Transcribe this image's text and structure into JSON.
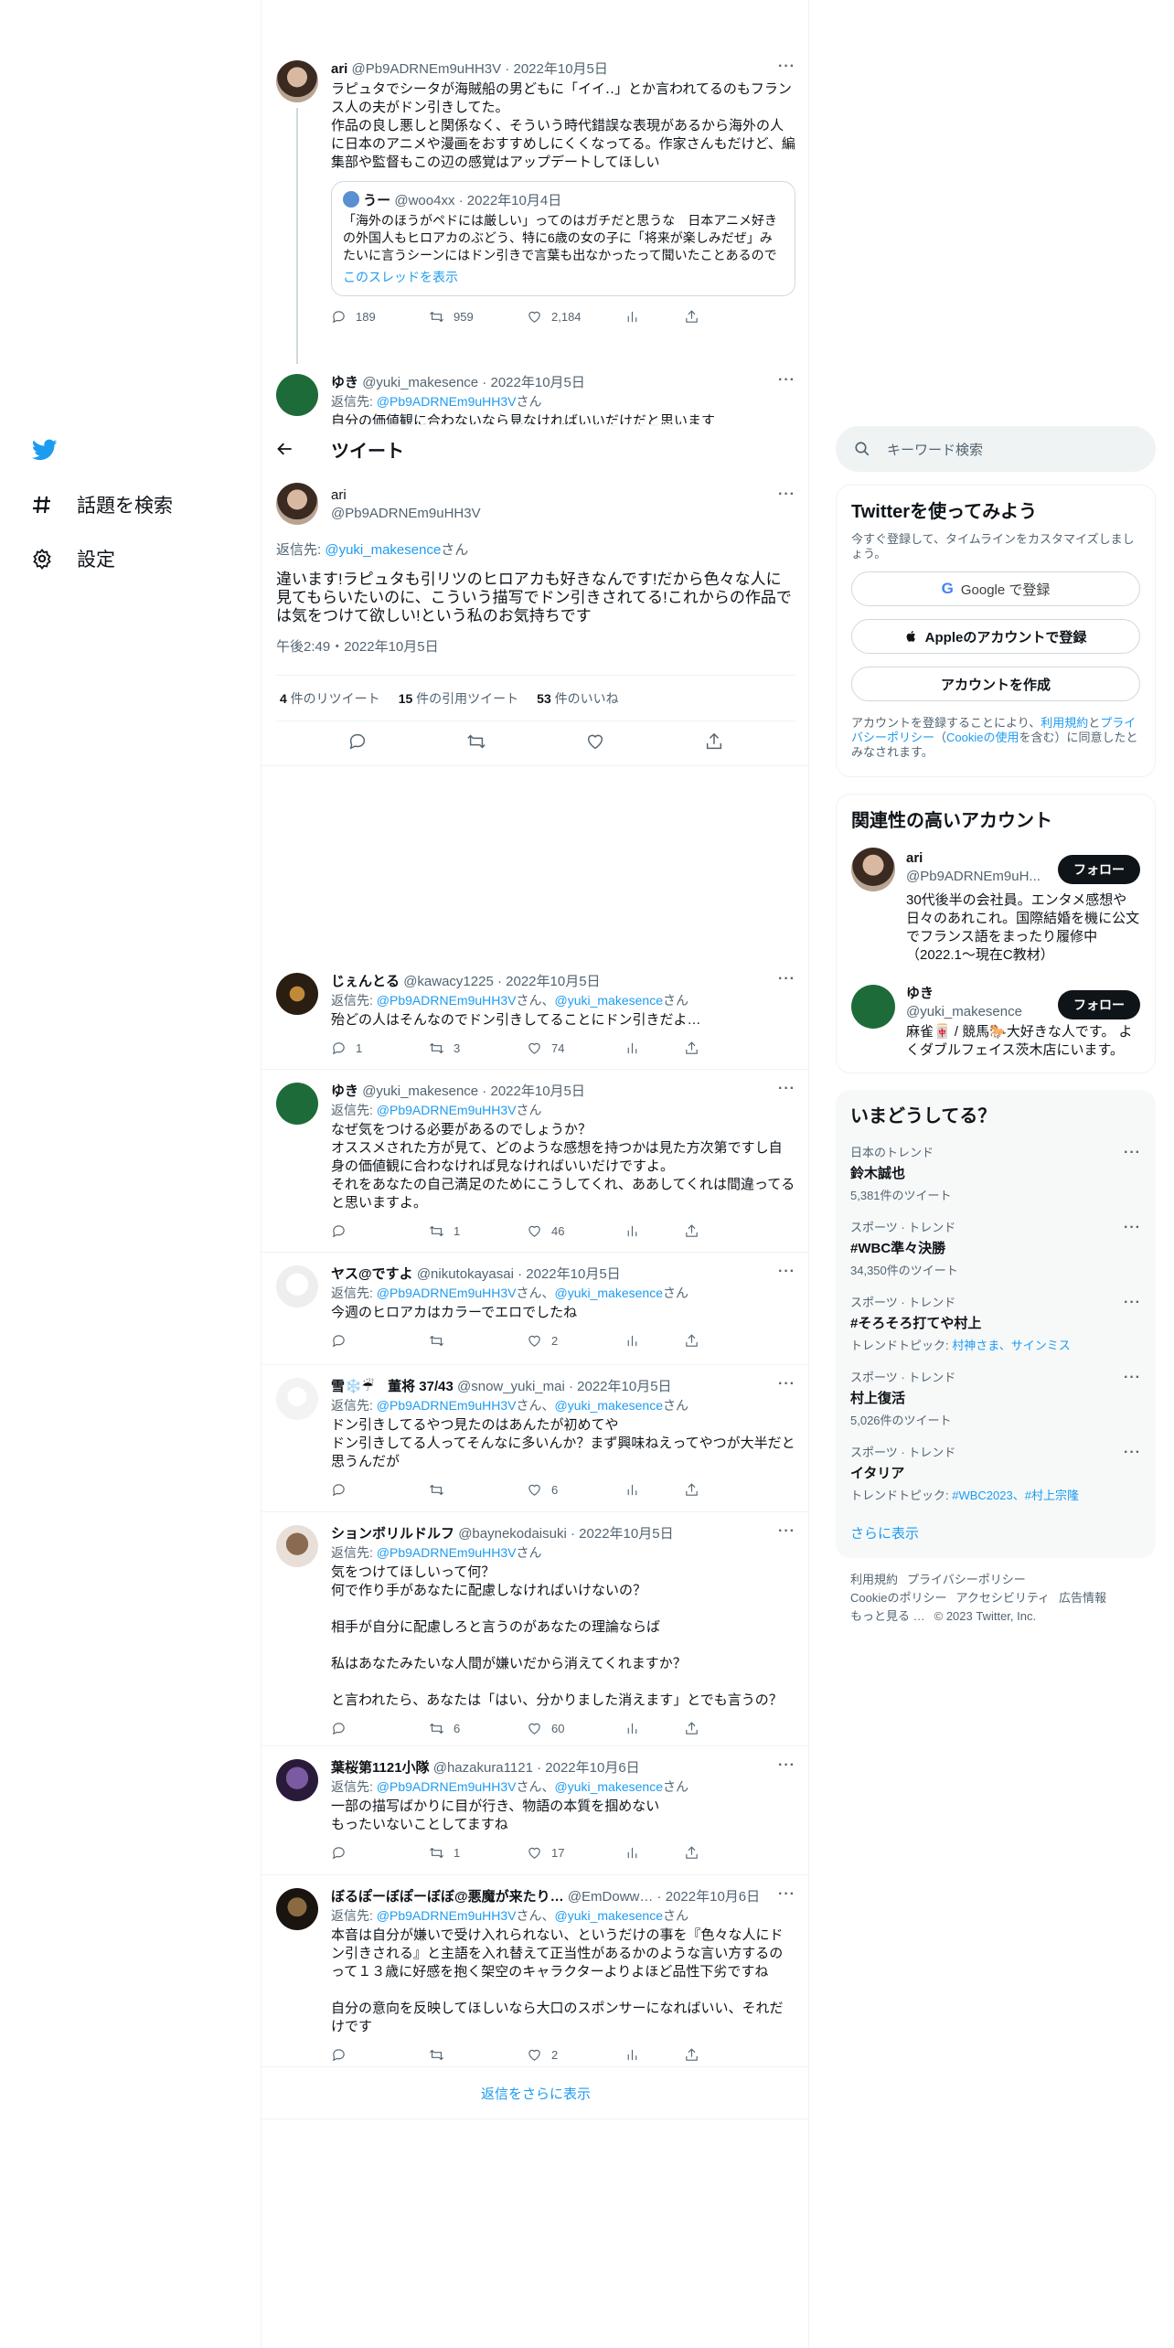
{
  "nav": {
    "explore_label": "話題を検索",
    "settings_label": "設定"
  },
  "thread_header": {
    "title": "ツイート"
  },
  "top_tweet": {
    "name": "ari",
    "handle": "@Pb9ADRNEm9uHH3V",
    "date": "2022年10月5日",
    "text": "ラピュタでシータが海賊船の男どもに「イイ‥」とか言われてるのもフランス人の夫がドン引きしてた。\n作品の良し悪しと関係なく、そういう時代錯誤な表現があるから海外の人に日本のアニメや漫画をおすすめしにくくなってる。作家さんもだけど、編集部や監督もこの辺の感覚はアップデートしてほしい",
    "quote": {
      "name": "うー",
      "handle": "@woo4xx",
      "date": "2022年10月4日",
      "text": "「海外のほうがペドには厳しい」ってのはガチだと思うな　日本アニメ好きの外国人もヒロアカのぶどう、特に6歳の女の子に「将来が楽しみだぜ」みたいに言うシーンにはドン引きで言葉も出なかったって聞いたことあるので",
      "link": "このスレッドを表示"
    },
    "replies": "189",
    "retweets": "959",
    "likes": "2,184"
  },
  "yuki_partial": {
    "name": "ゆき",
    "handle": "@yuki_makesence",
    "date": "2022年10月5日",
    "replying_prefix": "返信先: ",
    "replying_to": "@Pb9ADRNEm9uHH3V",
    "replying_suffix": "さん",
    "text": "自分の価値観に合わないなら見なければいいだけだと思います"
  },
  "focal": {
    "name": "ari",
    "handle": "@Pb9ADRNEm9uHH3V",
    "replying_prefix": "返信先: ",
    "replying_to": "@yuki_makesence",
    "replying_suffix": "さん",
    "text": "違います!ラピュタも引リツのヒロアカも好きなんです!だから色々な人に見てもらいたいのに、こういう描写でドン引きされてる!これからの作品では気をつけて欲しい!という私のお気持ちです",
    "time": "午後2:49・2022年10月5日",
    "retweets_num": "4",
    "retweets_label": " 件のリツイート",
    "quotes_num": "15",
    "quotes_label": " 件の引用ツイート",
    "likes_num": "53",
    "likes_label": " 件のいいね"
  },
  "replies": [
    {
      "name": "じぇんとる",
      "handle": "@kawacy1225",
      "date": "2022年10月5日",
      "to": [
        "@Pb9ADRNEm9uHH3V",
        "@yuki_makesence"
      ],
      "text": "殆どの人はそんなのでドン引きしてることにドン引きだよ…",
      "replies": "1",
      "retweets": "3",
      "likes": "74"
    },
    {
      "name": "ゆき",
      "handle": "@yuki_makesence",
      "date": "2022年10月5日",
      "to": [
        "@Pb9ADRNEm9uHH3V"
      ],
      "text": "なぜ気をつける必要があるのでしょうか？\nオススメされた方が見て、どのような感想を持つかは見た方次第ですし自身の価値観に合わなければ見なければいいだけですよ。\nそれをあなたの自己満足のためにこうしてくれ、ああしてくれは間違ってると思いますよ。",
      "replies": "",
      "retweets": "1",
      "likes": "46"
    },
    {
      "name": "ヤス@ですよ",
      "handle": "@nikutokayasai",
      "date": "2022年10月5日",
      "to": [
        "@Pb9ADRNEm9uHH3V",
        "@yuki_makesence"
      ],
      "text": "今週のヒロアカはカラーでエロでしたね",
      "replies": "",
      "retweets": "",
      "likes": "2"
    },
    {
      "name": "雪❄️☔　董将 37/43",
      "handle": "@snow_yuki_mai",
      "date": "2022年10月5日",
      "to": [
        "@Pb9ADRNEm9uHH3V",
        "@yuki_makesence"
      ],
      "text": "ドン引きしてるやつ見たのはあんたが初めてや\nドン引きしてる人ってそんなに多いんか？まず興味ねえってやつが大半だと思うんだが",
      "replies": "",
      "retweets": "",
      "likes": "6"
    },
    {
      "name": "ションボリルドルフ",
      "handle": "@baynekodaisuki",
      "date": "2022年10月5日",
      "to": [
        "@Pb9ADRNEm9uHH3V"
      ],
      "text": "気をつけてほしいって何？\n何で作り手があなたに配慮しなければいけないの？\n\n相手が自分に配慮しろと言うのがあなたの理論ならば\n\n私はあなたみたいな人間が嫌いだから消えてくれますか？\n\nと言われたら、あなたは「はい、分かりました消えます」とでも言うの？",
      "replies": "",
      "retweets": "6",
      "likes": "60"
    },
    {
      "name": "葉桜第1121小隊",
      "handle": "@hazakura1121",
      "date": "2022年10月6日",
      "to": [
        "@Pb9ADRNEm9uHH3V",
        "@yuki_makesence"
      ],
      "text": "一部の描写ばかりに目が行き、物語の本質を掴めない\nもったいないことしてますね",
      "replies": "",
      "retweets": "1",
      "likes": "17"
    },
    {
      "name": "ぼるぽーぼぽーぼぼ@悪魔が来たり…",
      "handle": "@EmDoww…",
      "date": "2022年10月6日",
      "to": [
        "@Pb9ADRNEm9uHH3V",
        "@yuki_makesence"
      ],
      "text": "本音は自分が嫌いで受け入れられない、というだけの事を『色々な人にドン引きされる』と主語を入れ替えて正当性があるかのような言い方するのって１３歳に好感を抱く架空のキャラクターよりよほど品性下劣ですね\n\n自分の意向を反映してほしいなら大口のスポンサーになればいい、それだけです",
      "replies": "",
      "retweets": "",
      "likes": "2"
    }
  ],
  "reply_common": {
    "replying_prefix": "返信先: ",
    "san": "さん",
    "sep": "、"
  },
  "show_more_replies": "返信をさらに表示",
  "search": {
    "placeholder": "キーワード検索"
  },
  "signup": {
    "title": "Twitterを使ってみよう",
    "subtitle": "今すぐ登録して、タイムラインをカスタマイズしましょう。",
    "google": "Google で登録",
    "apple": "Appleのアカウントで登録",
    "create": "アカウントを作成",
    "terms_pre": "アカウントを登録することにより、",
    "terms_link": "利用規約",
    "terms_and": "と",
    "privacy_link": "プライバシーポリシー",
    "paren_open": "（",
    "cookie_link": "Cookieの使用",
    "terms_post": "を含む）に同意したとみなされます。"
  },
  "relevant": {
    "title": "関連性の高いアカウント",
    "accounts": [
      {
        "name": "ari",
        "handle": "@Pb9ADRNEm9uH...",
        "follow": "フォロー",
        "bio": "30代後半の会社員。エンタメ感想や日々のあれこれ。国際結婚を機に公文でフランス語をまったり履修中（2022.1〜現在C教材）"
      },
      {
        "name": "ゆき",
        "handle": "@yuki_makesence",
        "follow": "フォロー",
        "bio": "麻雀🀄 / 競馬🐎大好きな人です。 よくダブルフェイス茨木店にいます。"
      }
    ]
  },
  "trends": {
    "title": "いまどうしてる？",
    "items": [
      {
        "category": "日本のトレンド",
        "name": "鈴木誠也",
        "count": "5,381件のツイート"
      },
      {
        "category": "スポーツ · トレンド",
        "name": "#WBC準々決勝",
        "count": "34,350件のツイート"
      },
      {
        "category": "スポーツ · トレンド",
        "name": "#そろそろ打てや村上",
        "topic_label": "トレンドトピック: ",
        "topic_links": "村神さま、サインミス"
      },
      {
        "category": "スポーツ · トレンド",
        "name": "村上復活",
        "count": "5,026件のツイート"
      },
      {
        "category": "スポーツ · トレンド",
        "name": "イタリア",
        "topic_label": "トレンドトピック: ",
        "topic_links": "#WBC2023、#村上宗隆"
      }
    ],
    "show_more": "さらに表示"
  },
  "footer": {
    "line1": [
      "利用規約",
      "プライバシーポリシー"
    ],
    "line2": [
      "Cookieのポリシー",
      "アクセシビリティ",
      "広告情報"
    ],
    "line3": [
      "もっと見る …",
      "© 2023 Twitter, Inc."
    ]
  },
  "colors": {
    "accent": "#1d9bf0",
    "text": "#0f1419",
    "secondary": "#536471",
    "border": "#eff3f4"
  }
}
